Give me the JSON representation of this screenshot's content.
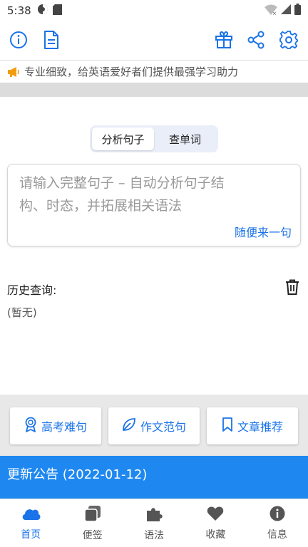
{
  "status_bar": {
    "time": "5:38"
  },
  "notice": {
    "text": "专业细致，给英语爱好者们提供最强学习助力"
  },
  "segment": {
    "options": [
      "分析句子",
      "查单词"
    ],
    "selected": "分析句子"
  },
  "input": {
    "placeholder_line1": "请输入完整句子 – 自动分析句子结",
    "placeholder_line2": "构、时态，并拓展相关语法",
    "random_label": "随便来一句"
  },
  "history": {
    "title": "历史查询:",
    "empty": "(暂无)"
  },
  "shortcuts": [
    {
      "label": "高考难句",
      "icon": "award-icon"
    },
    {
      "label": "作文范句",
      "icon": "leaf-icon"
    },
    {
      "label": "文章推荐",
      "icon": "bookmark-icon"
    }
  ],
  "announcement": {
    "title": "更新公告 (2022-01-12)"
  },
  "tabs": [
    {
      "label": "首页",
      "icon": "cloud-icon",
      "active": true
    },
    {
      "label": "便签",
      "icon": "notes-icon",
      "active": false
    },
    {
      "label": "语法",
      "icon": "puzzle-icon",
      "active": false
    },
    {
      "label": "收藏",
      "icon": "heart-icon",
      "active": false
    },
    {
      "label": "信息",
      "icon": "info-icon",
      "active": false
    }
  ],
  "colors": {
    "accent": "#1a73e8",
    "announce_bg": "#1e88f0",
    "notice_icon": "#f39c12"
  }
}
